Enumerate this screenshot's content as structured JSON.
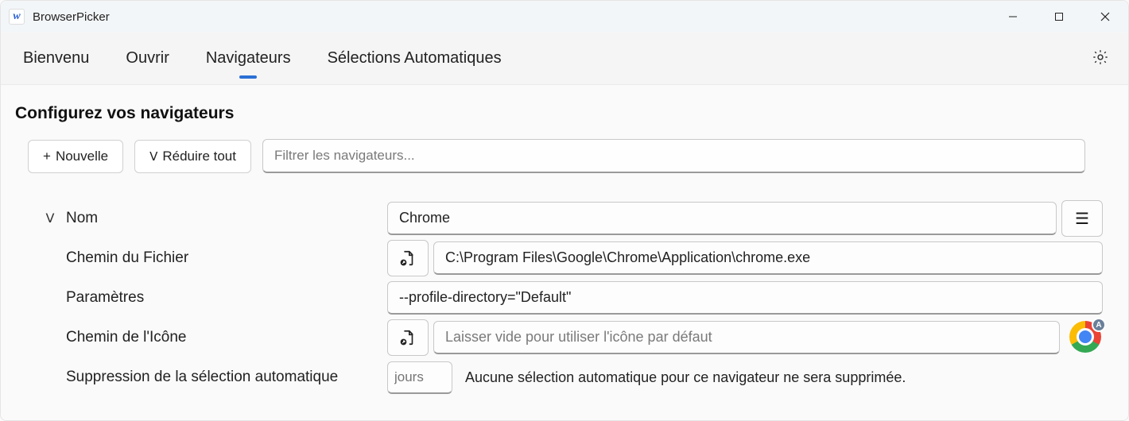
{
  "app": {
    "title": "BrowserPicker",
    "icon_glyph": "w"
  },
  "tabs": [
    {
      "label": "Bienvenu",
      "active": false
    },
    {
      "label": "Ouvrir",
      "active": false
    },
    {
      "label": "Navigateurs",
      "active": true
    },
    {
      "label": "Sélections Automatiques",
      "active": false
    }
  ],
  "page": {
    "title": "Configurez vos navigateurs"
  },
  "toolbar": {
    "new_label": "Nouvelle",
    "new_prefix": "+",
    "collapse_label": "Réduire tout",
    "collapse_prefix": "ˬ",
    "filter_placeholder": "Filtrer les navigateurs..."
  },
  "browser": {
    "expand_glyph": "ˬ",
    "name_label": "Nom",
    "name_value": "Chrome",
    "filepath_label": "Chemin du Fichier",
    "filepath_value": "C:\\Program Files\\Google\\Chrome\\Application\\chrome.exe",
    "params_label": "Paramètres",
    "params_value": "--profile-directory=\"Default\"",
    "iconpath_label": "Chemin de l'Icône",
    "iconpath_placeholder": "Laisser vide pour utiliser l'icône par défaut",
    "autosupp_label": "Suppression de la sélection automatique",
    "days_placeholder": "jours",
    "autosupp_help": "Aucune sélection automatique pour ce navigateur ne sera supprimée.",
    "badge_letter": "A"
  }
}
